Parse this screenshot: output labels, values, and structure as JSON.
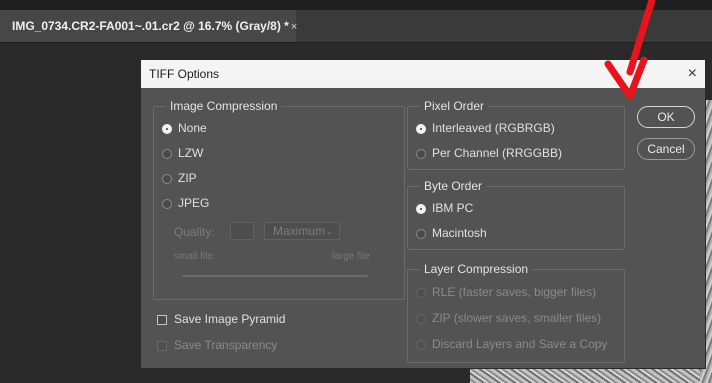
{
  "document_tab": {
    "title": "IMG_0734.CR2-FA001~.01.cr2 @ 16.7% (Gray/8) *",
    "close": "×"
  },
  "dialog": {
    "title": "TIFF Options",
    "close": "×",
    "image_compression": {
      "legend": "Image Compression",
      "options": [
        "None",
        "LZW",
        "ZIP",
        "JPEG"
      ],
      "selected": "None",
      "quality_label": "Quality:",
      "quality_value": "",
      "quality_preset": "Maximum",
      "small_file": "small file",
      "large_file": "large file"
    },
    "pixel_order": {
      "legend": "Pixel Order",
      "options": [
        "Interleaved (RGBRGB)",
        "Per Channel (RRGGBB)"
      ],
      "selected": "Interleaved (RGBRGB)"
    },
    "byte_order": {
      "legend": "Byte Order",
      "options": [
        "IBM PC",
        "Macintosh"
      ],
      "selected": "IBM PC"
    },
    "layer_compression": {
      "legend": "Layer Compression",
      "options": [
        "RLE (faster saves, bigger files)",
        "ZIP (slower saves, smaller files)",
        "Discard Layers and Save a Copy"
      ]
    },
    "save_image_pyramid": {
      "label": "Save Image Pyramid",
      "checked": false
    },
    "save_transparency": {
      "label": "Save Transparency",
      "checked": false,
      "enabled": false
    },
    "buttons": {
      "ok": "OK",
      "cancel": "Cancel"
    }
  },
  "colors": {
    "annotation_arrow": "#e8141b",
    "dialog_bg": "#535353",
    "titlebar_bg": "#f4f4f4"
  }
}
